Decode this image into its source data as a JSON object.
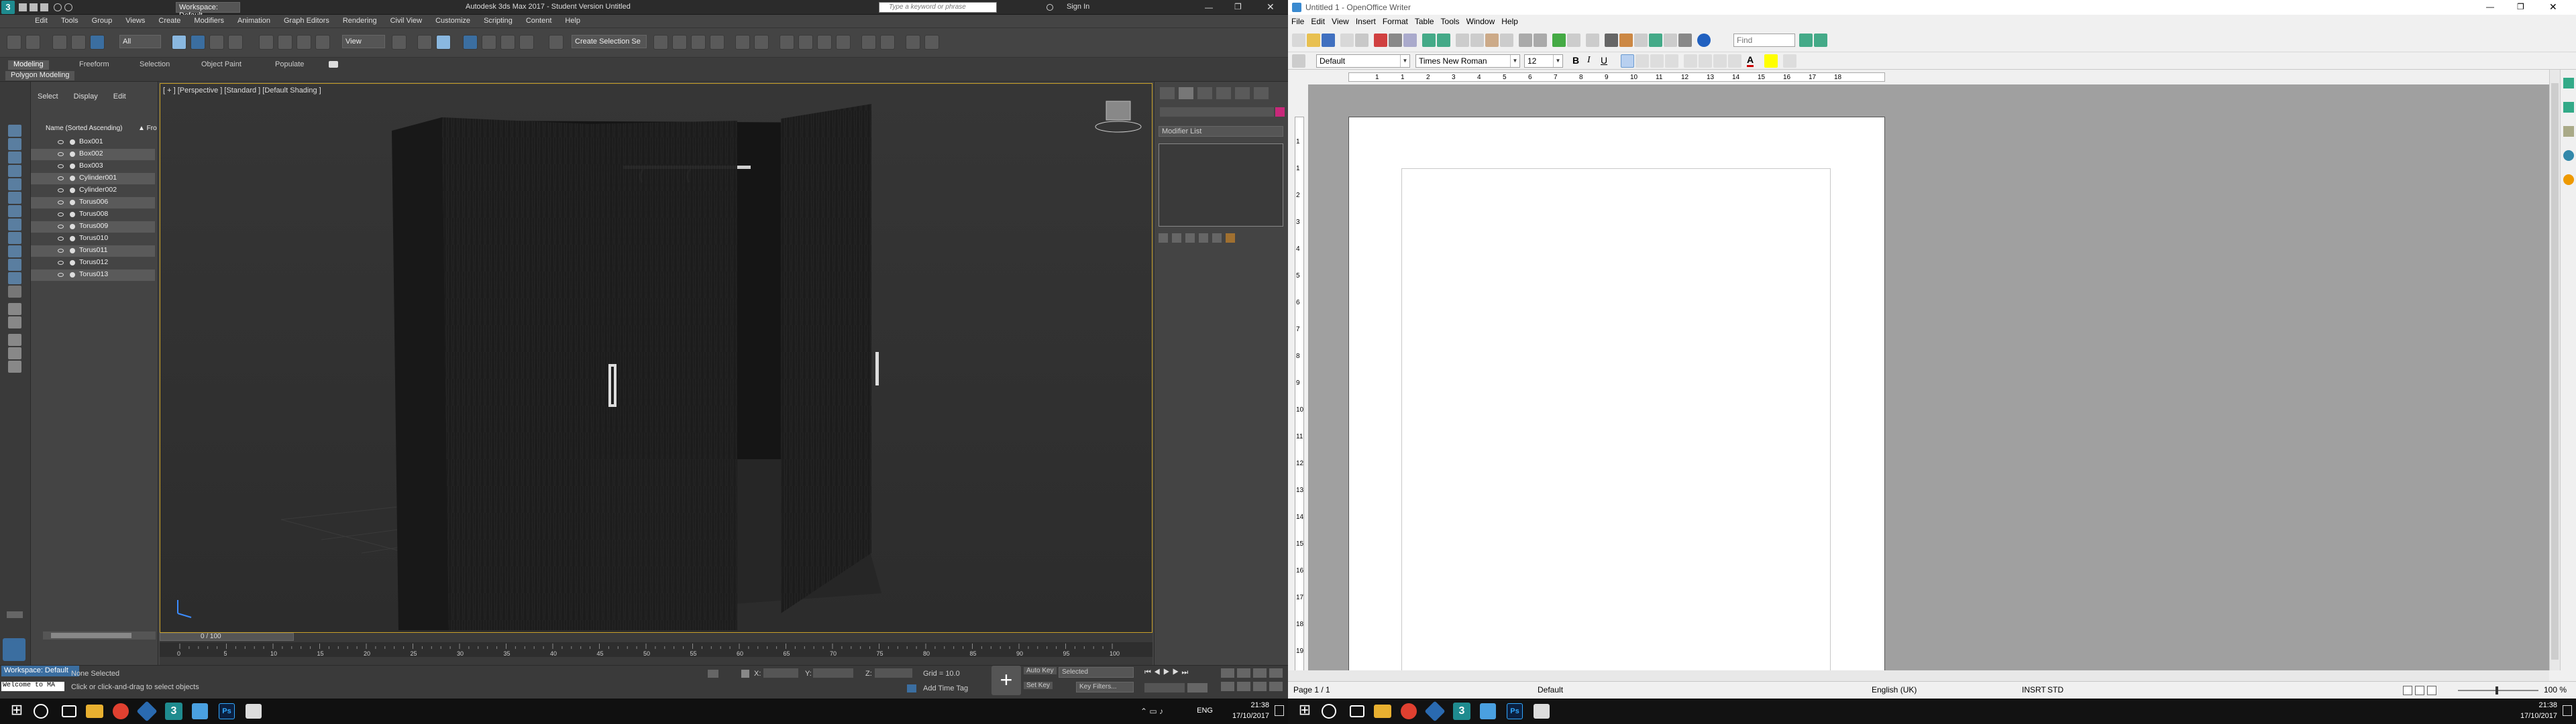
{
  "max": {
    "workspace": "Workspace: Default",
    "title": "Autodesk 3ds Max 2017 - Student Version   Untitled",
    "search_placeholder": "Type a keyword or phrase",
    "sign_in": "Sign In",
    "menu": [
      "Edit",
      "Tools",
      "Group",
      "Views",
      "Create",
      "Modifiers",
      "Animation",
      "Graph Editors",
      "Rendering",
      "Civil View",
      "Customize",
      "Scripting",
      "Content",
      "Help"
    ],
    "toolbar": {
      "filter": "All",
      "view": "View",
      "selection_set": "Create Selection Se"
    },
    "ribbon": {
      "tabs": [
        "Modeling",
        "Freeform",
        "Selection",
        "Object Paint",
        "Populate"
      ],
      "active": "Modeling",
      "sub": "Polygon Modeling"
    },
    "scene_explorer": {
      "tabs": [
        "Select",
        "Display",
        "Edit"
      ],
      "header": "Name (Sorted Ascending)",
      "header_right": "▲ Fro",
      "items": [
        "Box001",
        "Box002",
        "Box003",
        "Cylinder001",
        "Cylinder002",
        "Torus006",
        "Torus008",
        "Torus009",
        "Torus010",
        "Torus011",
        "Torus012",
        "Torus013"
      ],
      "selected_rows": [
        1,
        3,
        5,
        7,
        9,
        11
      ]
    },
    "viewport_label": "[ + ] [Perspective ] [Standard ] [Default Shading ]",
    "command_panel": {
      "modifier_list": "Modifier List"
    },
    "timeline": {
      "frame": "0 / 100",
      "ticks": [
        "0",
        "5",
        "10",
        "15",
        "20",
        "25",
        "30",
        "35",
        "40",
        "45",
        "50",
        "55",
        "60",
        "65",
        "70",
        "75",
        "80",
        "85",
        "90",
        "95",
        "100"
      ]
    },
    "status": {
      "workspace": "Workspace: Default",
      "selection": "None Selected",
      "prompt": "Click or click-and-drag to select objects",
      "x_label": "X:",
      "y_label": "Y:",
      "z_label": "Z:",
      "grid": "Grid = 10.0",
      "add_time_tag": "Add Time Tag",
      "auto_key": "Auto Key",
      "set_key": "Set Key",
      "selected": "Selected",
      "key_filters": "Key Filters...",
      "welcome": "Welcome to MA"
    }
  },
  "writer": {
    "title": "Untitled 1 - OpenOffice Writer",
    "menu": [
      "File",
      "Edit",
      "View",
      "Insert",
      "Format",
      "Table",
      "Tools",
      "Window",
      "Help"
    ],
    "find_placeholder": "Find",
    "style": "Default",
    "font": "Times New Roman",
    "size": "12",
    "ruler_numbers": [
      "1",
      "1",
      "2",
      "3",
      "4",
      "5",
      "6",
      "7",
      "8",
      "9",
      "10",
      "11",
      "12",
      "13",
      "14",
      "15",
      "16",
      "17",
      "18"
    ],
    "vruler_numbers": [
      "1",
      "1",
      "2",
      "3",
      "4",
      "5",
      "6",
      "7",
      "8",
      "9",
      "10",
      "11",
      "12",
      "13",
      "14",
      "15",
      "16",
      "17",
      "18",
      "19"
    ],
    "status": {
      "page": "Page 1 / 1",
      "style": "Default",
      "lang": "English (UK)",
      "mode": "INSRT",
      "std": "STD",
      "zoom": "100 %"
    }
  },
  "taskbar": {
    "time": "21:38",
    "date": "17/10/2017",
    "lang": "ENG",
    "apps": [
      "start",
      "search",
      "task-view",
      "file-explorer",
      "chrome",
      "app-blue",
      "3dsmax",
      "openoffice",
      "photoshop",
      "app-white"
    ]
  }
}
